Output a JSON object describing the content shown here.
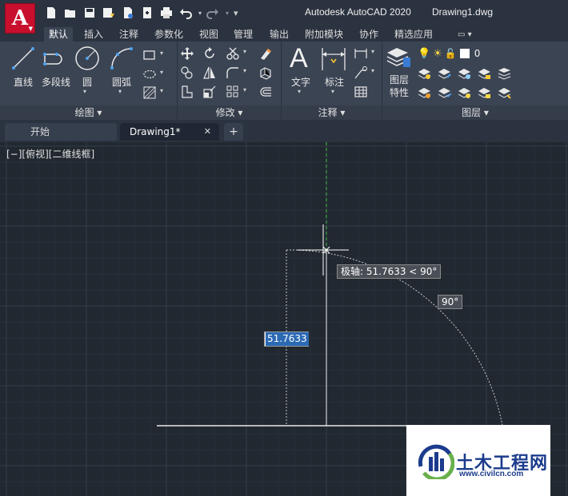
{
  "titlebar": {
    "app_title": "Autodesk AutoCAD 2020",
    "file_title": "Drawing1.dwg",
    "logo_letter": "A"
  },
  "ribbon_tabs": [
    "默认",
    "插入",
    "注释",
    "参数化",
    "视图",
    "管理",
    "输出",
    "附加模块",
    "协作",
    "精选应用"
  ],
  "ribbon": {
    "draw_tools": [
      "直线",
      "多段线",
      "圆",
      "圆弧"
    ],
    "panels": {
      "draw": "绘图 ▾",
      "modify": "修改 ▾",
      "annotation": "注释 ▾",
      "layers": "图层 ▾"
    },
    "annotation_tools": [
      "文字",
      "标注"
    ],
    "layer_props": "图层\n特性",
    "layer_props_line1": "图层",
    "layer_props_line2": "特性",
    "layer_name": "0"
  },
  "doc_tabs": {
    "start": "开始",
    "drawing": "Drawing1*",
    "close": "✕",
    "new": "+"
  },
  "canvas": {
    "view_label": "[−][俯视][二维线框]",
    "polar_tooltip": "极轴: 51.7633 < 90°",
    "angle_tooltip": "90°",
    "length_value": "51.7633"
  },
  "colors": {
    "logo_red": "#c8102e",
    "canvas_bg": "#212830",
    "polar_track": "#3fbf3f",
    "selection_blue": "#2c6ab4"
  },
  "watermark": {
    "text": "土木工程网",
    "url": "www.civilcn.com"
  }
}
